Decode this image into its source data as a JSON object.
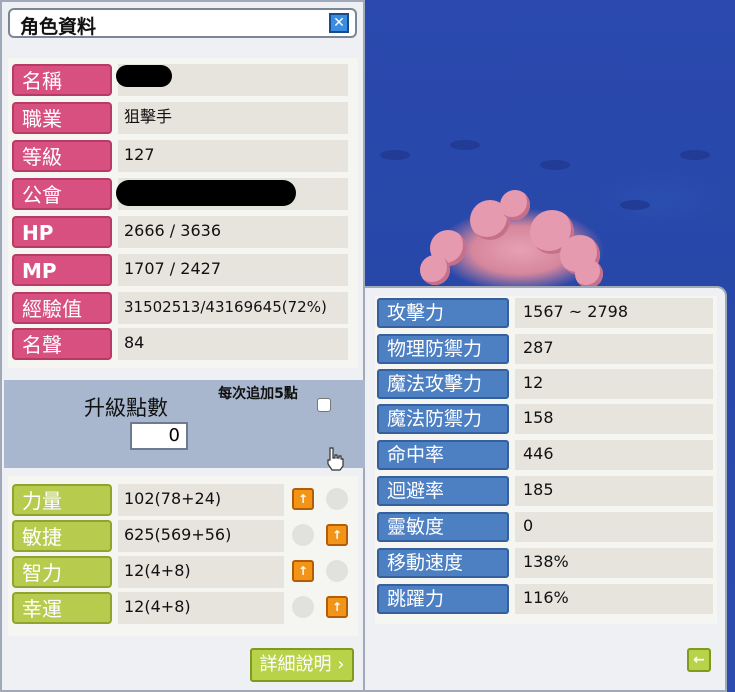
{
  "character": {
    "title": "角色資料",
    "close_label": "✕",
    "info": [
      {
        "label": "名稱",
        "value": ""
      },
      {
        "label": "職業",
        "value": "狙擊手"
      },
      {
        "label": "等級",
        "value": "127"
      },
      {
        "label": "公會",
        "value": ""
      },
      {
        "label": "HP",
        "value": "2666 / 3636"
      },
      {
        "label": "MP",
        "value": "1707 / 2427"
      },
      {
        "label": "經驗值",
        "value": "31502513/43169645(72%)"
      },
      {
        "label": "名聲",
        "value": "84"
      }
    ],
    "level_points": {
      "label": "升級點數",
      "value": "0",
      "add5_label": "每次追加5點"
    },
    "stats": [
      {
        "label": "力量",
        "value": "102(78+24)"
      },
      {
        "label": "敏捷",
        "value": "625(569+56)"
      },
      {
        "label": "智力",
        "value": "12(4+8)"
      },
      {
        "label": "幸運",
        "value": "12(4+8)"
      }
    ],
    "detail_button": "詳細說明",
    "up_glyph": "↑"
  },
  "details": {
    "rows": [
      {
        "label": "攻擊力",
        "value": "1567 ~ 2798"
      },
      {
        "label": "物理防禦力",
        "value": "287"
      },
      {
        "label": "魔法攻擊力",
        "value": "12"
      },
      {
        "label": "魔法防禦力",
        "value": "158"
      },
      {
        "label": "命中率",
        "value": "446"
      },
      {
        "label": "迴避率",
        "value": "185"
      },
      {
        "label": "靈敏度",
        "value": "0"
      },
      {
        "label": "移動速度",
        "value": "138%"
      },
      {
        "label": "跳躍力",
        "value": "116%"
      }
    ],
    "back_glyph": "←"
  },
  "colors": {
    "pink_tag": "#d8507f",
    "green_tag": "#b7cb4f",
    "blue_tag": "#4d7fc3",
    "up_button": "#f29417",
    "scene_bg": "#2b49ae"
  }
}
